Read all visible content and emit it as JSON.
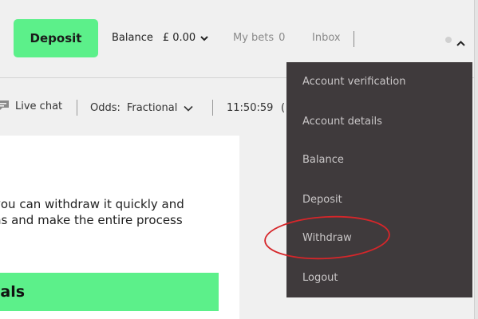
{
  "header": {
    "deposit_label": "Deposit",
    "balance_label": "Balance",
    "balance_amount": "£ 0.00",
    "mybets_label": "My bets",
    "mybets_count": "0",
    "inbox_label": "Inbox"
  },
  "subbar": {
    "livechat_label": "Live chat",
    "odds_label": "Odds:",
    "odds_value": "Fractional",
    "clock": "11:50:59",
    "clock_extra": "("
  },
  "content": {
    "line1": "you can withdraw it quickly and",
    "line2": "ns and make the entire process",
    "banner": "vals"
  },
  "account_menu": {
    "items": [
      {
        "label": "Account verification"
      },
      {
        "label": "Account details"
      },
      {
        "label": "Balance"
      },
      {
        "label": "Deposit"
      },
      {
        "label": "Withdraw"
      },
      {
        "label": "Logout"
      }
    ]
  },
  "colors": {
    "accent_green": "#5cf08a",
    "menu_bg": "#3f3a3c",
    "annotation_red": "#d6262a"
  },
  "icons": {
    "chat": "chat-bubble-icon",
    "chevron_down": "chevron-down-icon",
    "chevron_up": "chevron-up-icon"
  }
}
